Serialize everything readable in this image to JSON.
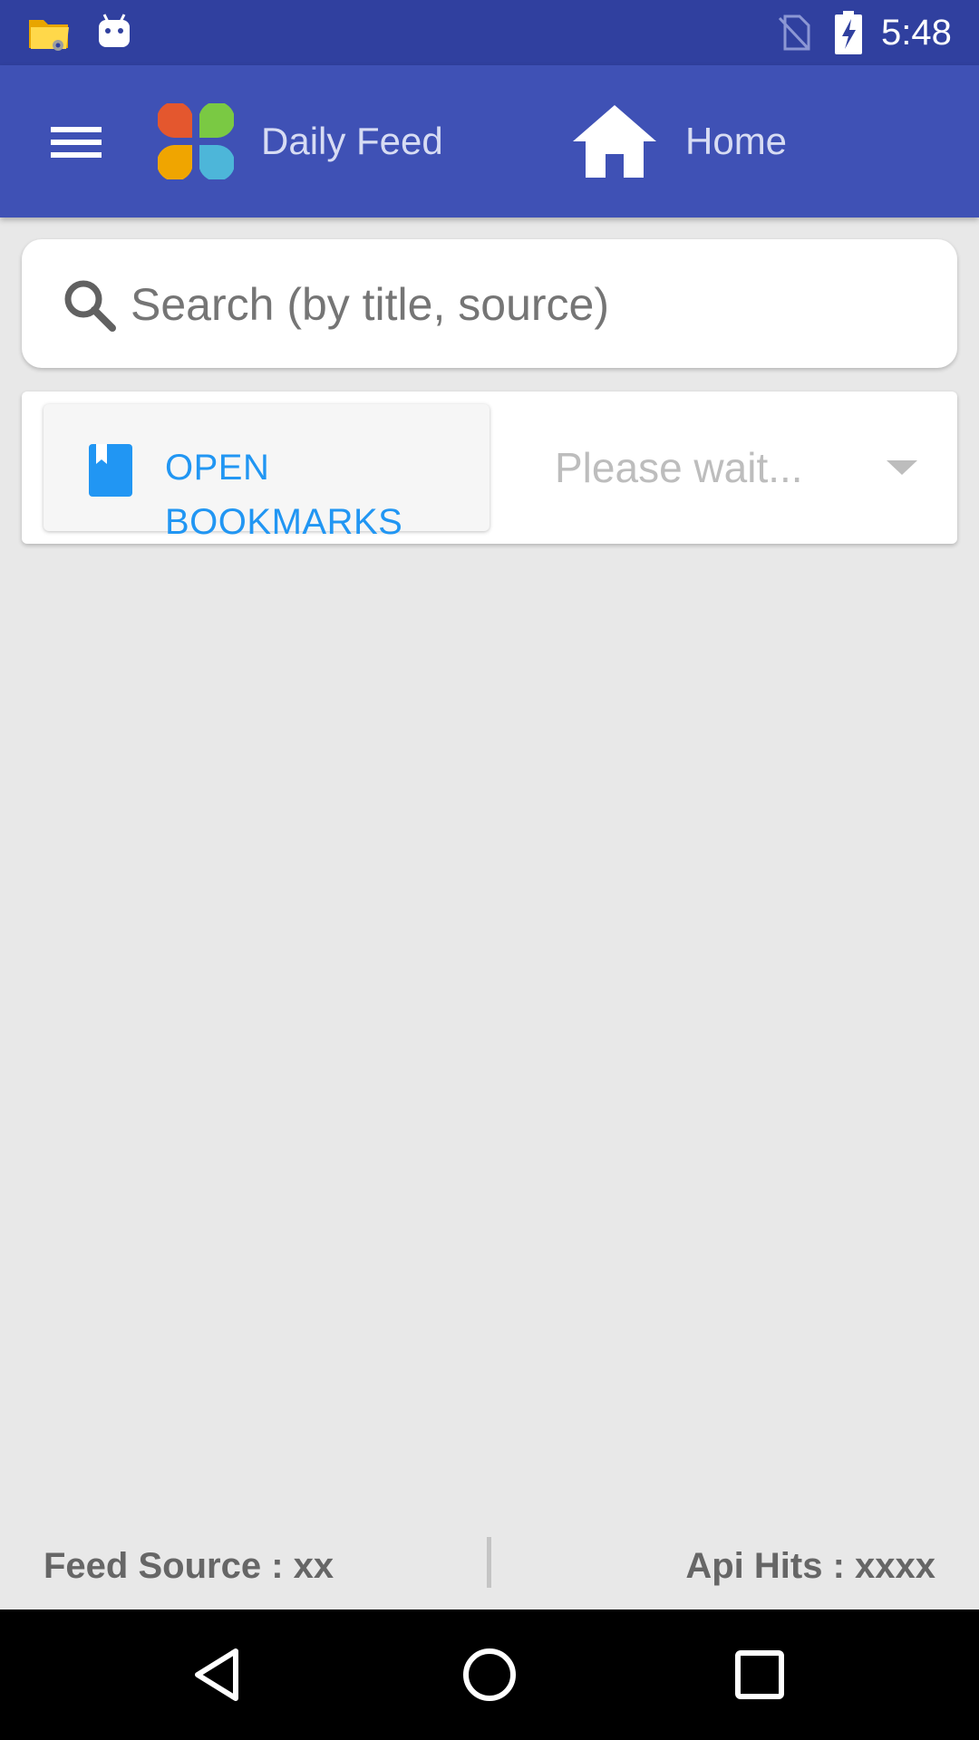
{
  "status_bar": {
    "time": "5:48",
    "icons": [
      "file-manager-notification-icon",
      "android-notification-icon",
      "no-sim-icon",
      "battery-charging-icon"
    ]
  },
  "app_bar": {
    "menu_icon": "hamburger-menu-icon",
    "logo": "daily-feed-logo",
    "title": "Daily Feed",
    "home_icon": "home-icon",
    "home_label": "Home"
  },
  "search": {
    "placeholder": "Search (by title, source)",
    "value": "",
    "icon": "search-icon"
  },
  "controls": {
    "bookmarks_label": "OPEN BOOKMARKS",
    "bookmark_icon": "bookmark-icon",
    "source_select_value": "Please wait..."
  },
  "footer": {
    "feed_source": "Feed Source : xx",
    "api_hits": "Api Hits : xxxx"
  },
  "nav_bar": {
    "icons": [
      "back-icon",
      "home-circle-icon",
      "recents-icon"
    ]
  },
  "colors": {
    "status_bar": "#30409f",
    "app_bar": "#3f51b5",
    "accent": "#2196f3",
    "background": "#e8e8e8"
  }
}
